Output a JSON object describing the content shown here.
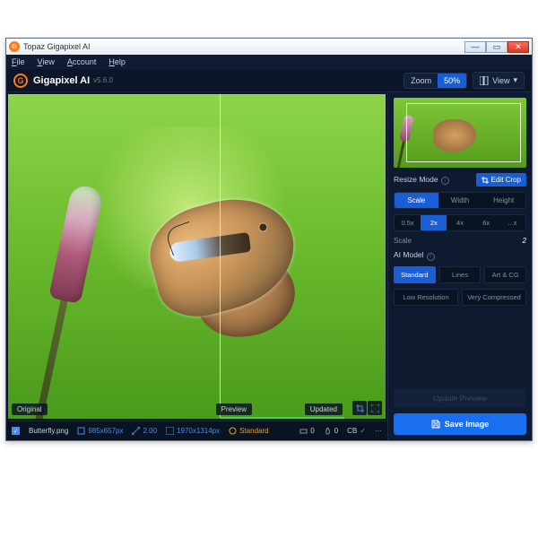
{
  "titlebar": {
    "title": "Topaz Gigapixel AI"
  },
  "menubar": {
    "file": "File",
    "view": "View",
    "account": "Account",
    "help": "Help"
  },
  "header": {
    "app_name": "Gigapixel AI",
    "version": "v5.6.0",
    "zoom_label": "Zoom",
    "zoom_value": "50%",
    "view_label": "View"
  },
  "viewport": {
    "original_label": "Original",
    "preview_label": "Preview",
    "updated_label": "Updated"
  },
  "filebar": {
    "filename": "Butterfly.png",
    "orig_dims": "985x657px",
    "scale": "2.00",
    "out_dims": "1970x1314px",
    "model": "Standard",
    "noise": "0",
    "blur": "0",
    "cb": "CB"
  },
  "panel": {
    "resize_title": "Resize Mode",
    "edit_crop": "Edit Crop",
    "tabs": {
      "scale": "Scale",
      "width": "Width",
      "height": "Height"
    },
    "mults": {
      "m05": "0.5x",
      "m2": "2x",
      "m4": "4x",
      "m6": "6x",
      "mc": "...x"
    },
    "scale_label": "Scale",
    "scale_value": "2",
    "ai_title": "AI Model",
    "models": {
      "standard": "Standard",
      "lines": "Lines",
      "artcg": "Art & CG",
      "lowres": "Low Resolution",
      "vc": "Very Compressed"
    },
    "update_preview": "Update Preview",
    "save_image": "Save Image"
  }
}
